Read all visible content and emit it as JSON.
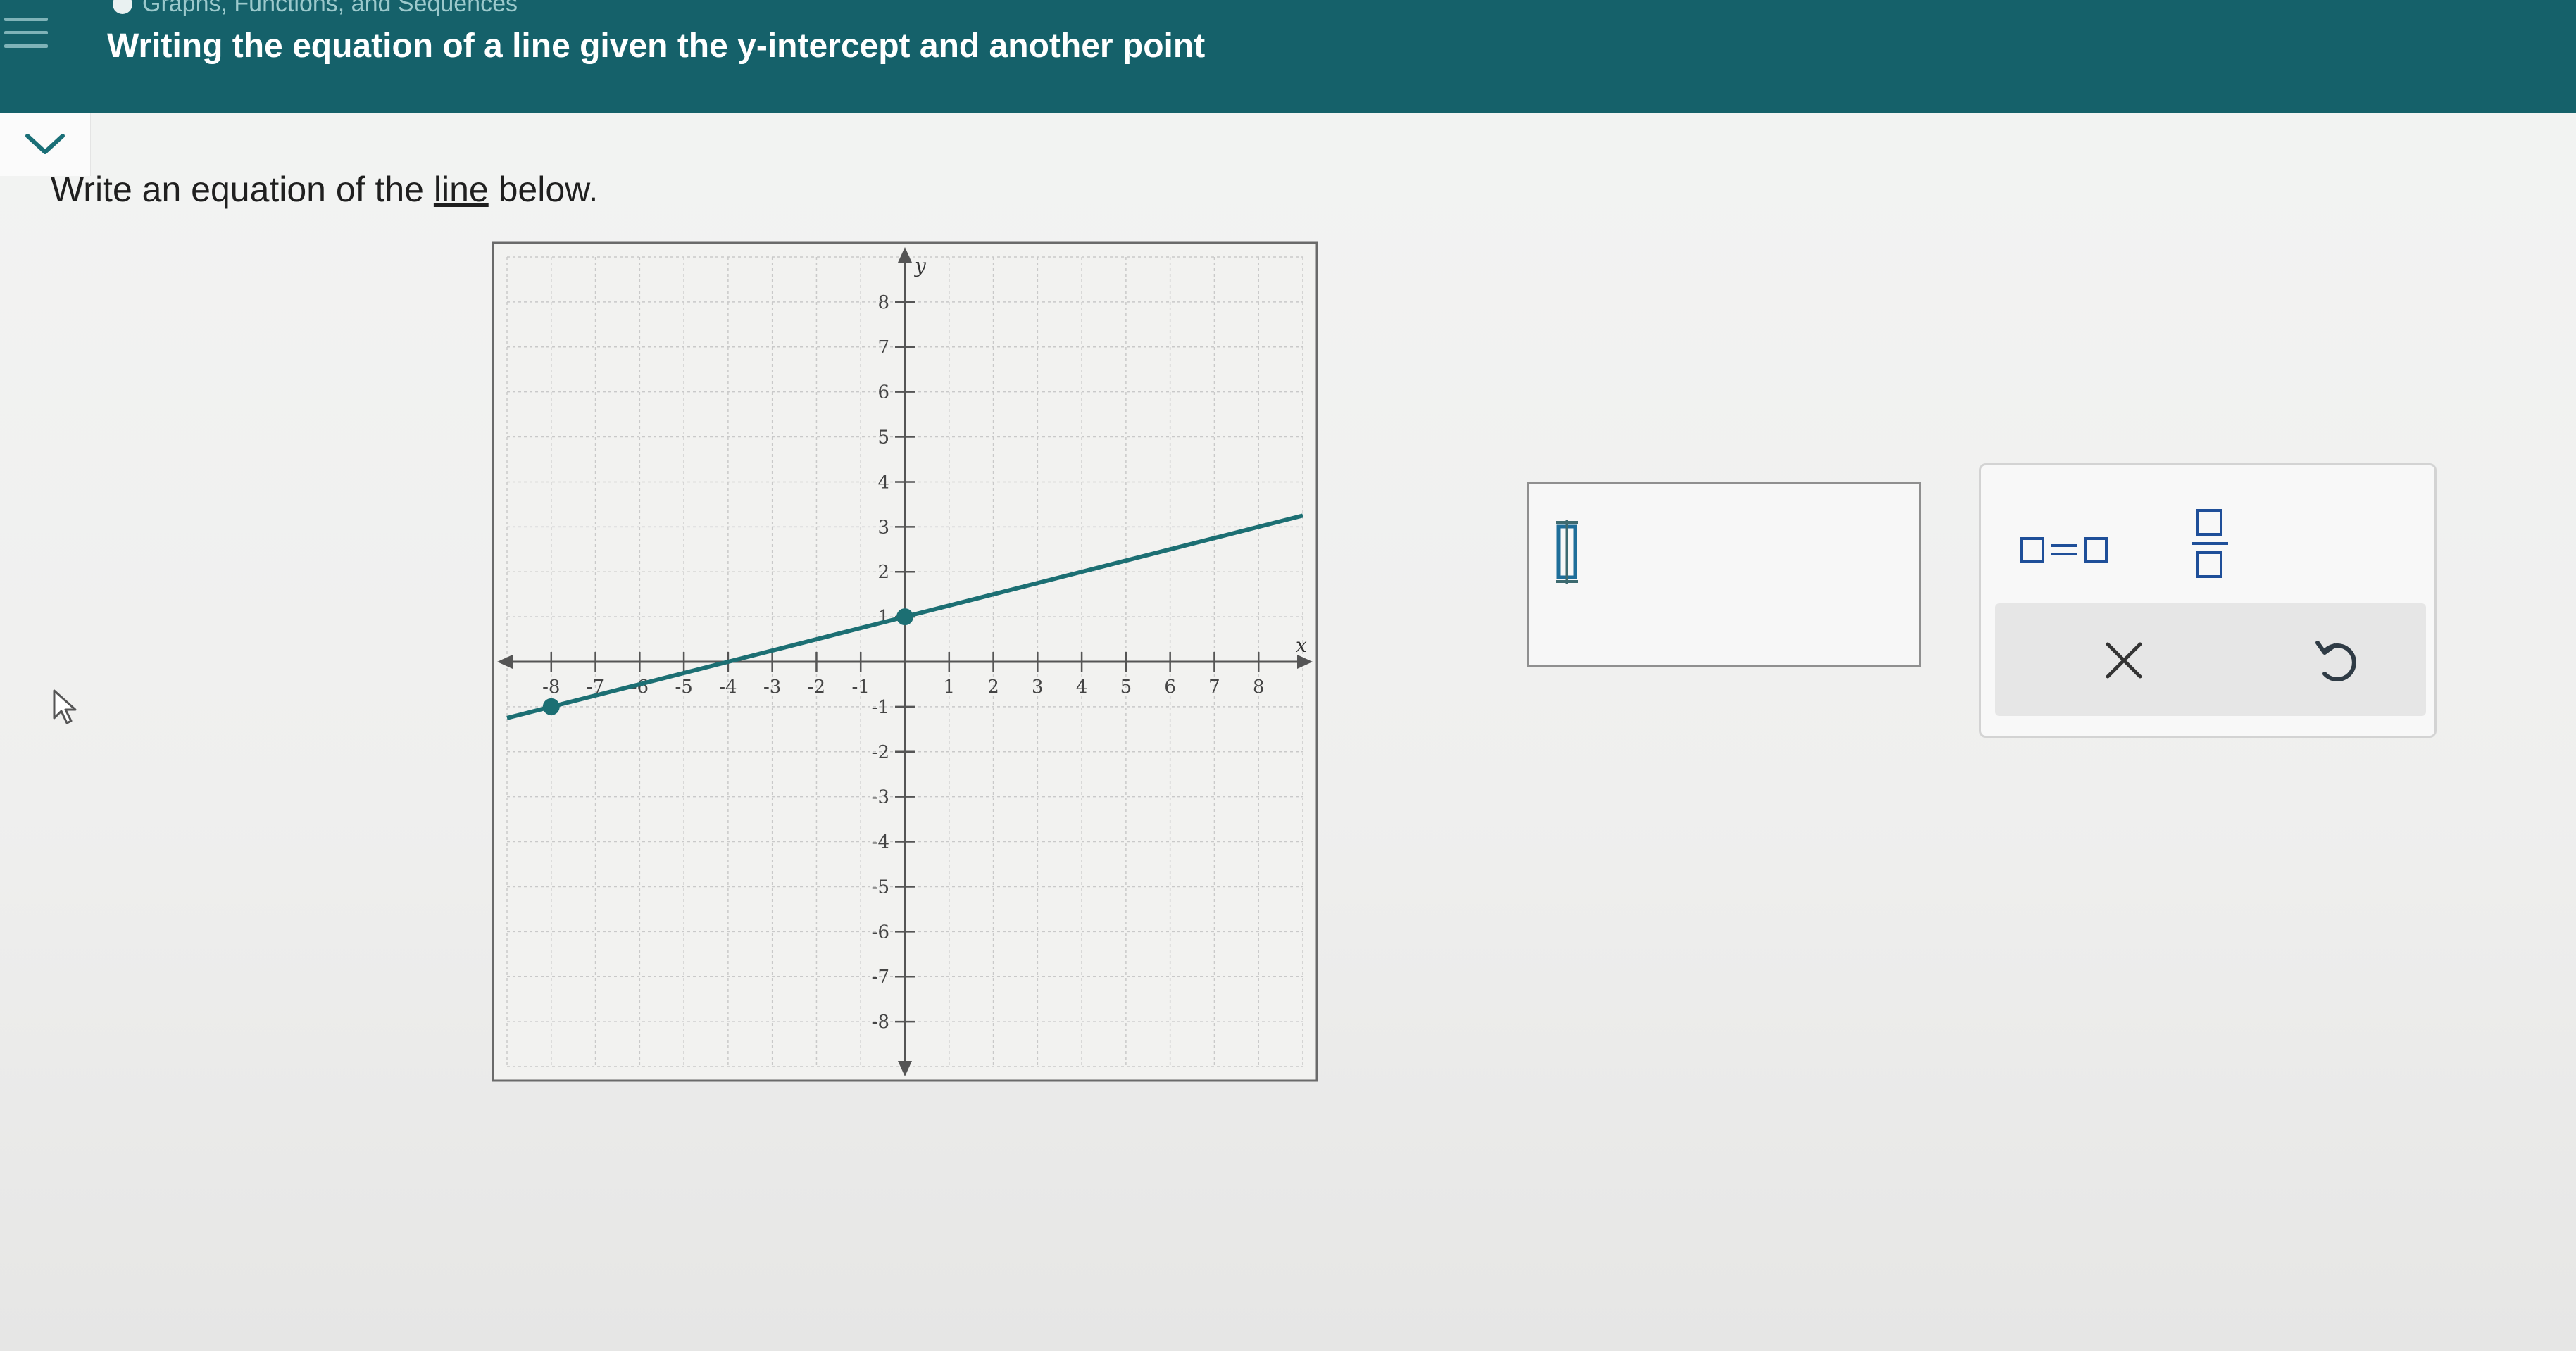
{
  "header": {
    "breadcrumb": "Graphs, Functions, and Sequences",
    "title": "Writing the equation of a line given the y-intercept and another point"
  },
  "question": {
    "prefix": "Write an equation of the ",
    "link": "line",
    "suffix": " below."
  },
  "graph": {
    "x_label": "x",
    "y_label": "y",
    "x_ticks": [
      "-8",
      "-7",
      "-6",
      "-5",
      "-4",
      "-3",
      "-2",
      "-1",
      "1",
      "2",
      "3",
      "4",
      "5",
      "6",
      "7",
      "8"
    ],
    "y_ticks": [
      "8",
      "7",
      "6",
      "5",
      "4",
      "3",
      "2",
      "1",
      "-1",
      "-2",
      "-3",
      "-4",
      "-5",
      "-6",
      "-7",
      "-8"
    ],
    "x_range": [
      -8,
      8
    ],
    "y_range": [
      -8,
      8
    ],
    "line_color": "#1c6f73",
    "points": [
      {
        "x": 0,
        "y": 1
      },
      {
        "x": -8,
        "y": -1
      }
    ]
  },
  "keypad": {
    "equals_icon": "box-equals-box-icon",
    "fraction_icon": "fraction-icon",
    "clear_icon": "x-icon",
    "undo_icon": "undo-icon"
  }
}
